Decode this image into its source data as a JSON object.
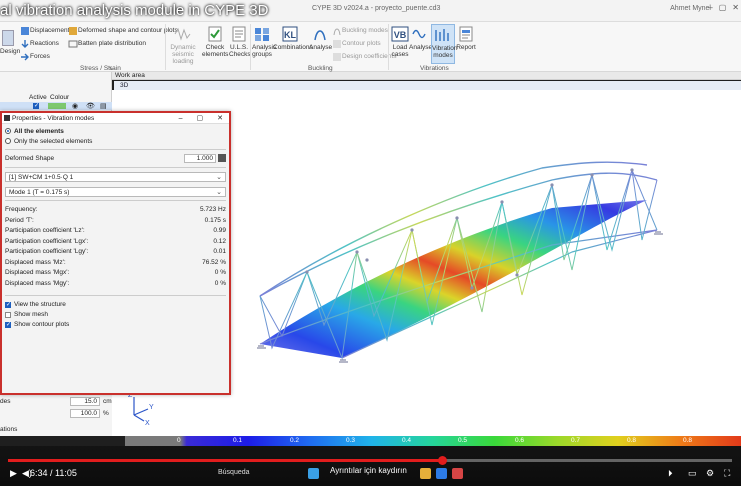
{
  "video": {
    "title": "al vibration analysis module in CYPE 3D",
    "time": "6:34 / 11:05",
    "caption": "Ayrıntılar için kaydırın",
    "progress_fraction": 0.6
  },
  "app": {
    "title": "CYPE 3D v2024.a - proyecto_puente.cd3",
    "user": "Ahmet Mynel"
  },
  "ribbon": {
    "stress_group": {
      "label": "Stress / Strain",
      "items": [
        "Displacements",
        "Reactions",
        "Forces",
        "Deformed shape and contour plots",
        "Batten plate distribution"
      ]
    },
    "left_btn": "Design",
    "dynamic_btn": "Dynamic seismic loading",
    "check_btn": "Check elements",
    "uls_btn": "U.L.S. Checks",
    "buckling_group": {
      "label": "Buckling",
      "analysis_groups": "Analysis groups",
      "combinations": "Combinations",
      "analyse": "Analyse",
      "buckling_modes": "Buckling modes",
      "contour_plots": "Contour plots",
      "design_coefficients": "Design coefficients"
    },
    "vibrations_group": {
      "label": "Vibrations",
      "load_cases": "Load cases",
      "analyse": "Analyse",
      "vibration_modes": "Vibration modes",
      "report": "Report"
    }
  },
  "left_panel": {
    "col_active": "Active",
    "col_colour": "Colour",
    "bottom_label": "des",
    "value_1": "15.0",
    "unit_1": "cm",
    "value_2": "100.0",
    "unit_2": "%",
    "footer": "ations"
  },
  "workarea": {
    "header": "Work area",
    "tab": "3D"
  },
  "dialog": {
    "title": "Properties - Vibration modes",
    "radio_all": "All the elements",
    "radio_selected": "Only the selected elements",
    "deformed_label": "Deformed Shape",
    "deformed_value": "1.000",
    "load_select": "[1] SW+CM 1+0.5·Q 1",
    "mode_select": "Mode 1 (T = 0.175 s)",
    "results": [
      {
        "label": "Frequency:",
        "value": "5.723",
        "unit": "Hz"
      },
      {
        "label": "Period 'T':",
        "value": "0.175",
        "unit": "s"
      },
      {
        "label": "Participation coefficient 'Lz':",
        "value": "0.99",
        "unit": ""
      },
      {
        "label": "Participation coefficient 'Lgx':",
        "value": "0.12",
        "unit": ""
      },
      {
        "label": "Participation coefficient 'Lgy':",
        "value": "0.01",
        "unit": ""
      },
      {
        "label": "Displaced mass 'Mz':",
        "value": "76.52",
        "unit": "%"
      },
      {
        "label": "Displaced mass 'Mgx':",
        "value": "0",
        "unit": "%"
      },
      {
        "label": "Displaced mass 'Mgy':",
        "value": "0",
        "unit": "%"
      }
    ],
    "check_view_structure": "View the structure",
    "check_show_mesh": "Show mesh",
    "check_contour": "Show contour plots"
  },
  "colorbar": {
    "labels": [
      "0",
      "0.1",
      "0.2",
      "0.3",
      "0.4",
      "0.5",
      "0.6",
      "0.7",
      "0.8",
      "0.8"
    ]
  },
  "taskbar": {
    "search": "Búsqueda"
  },
  "colors": {
    "dialog_border": "#c9302c",
    "yt_red": "#e21d1d",
    "accent_blue": "#1e5fbf"
  }
}
